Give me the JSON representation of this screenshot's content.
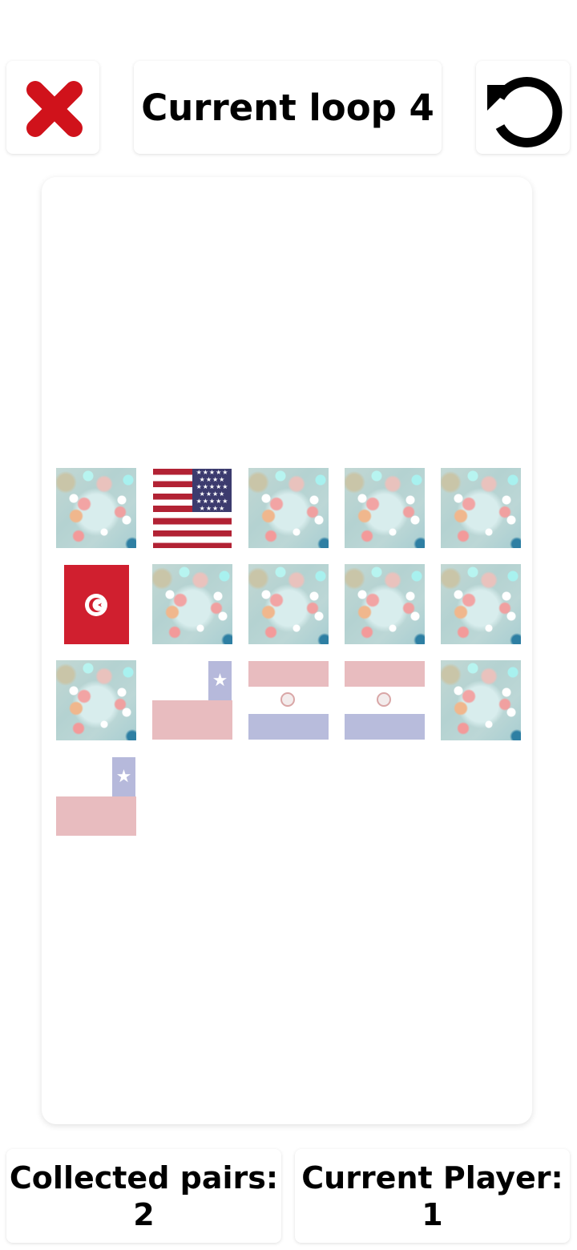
{
  "header": {
    "close_icon": "close-x-icon",
    "close_color": "#d0121b",
    "title": "Current loop 4",
    "restart_icon": "restart-icon"
  },
  "board": {
    "tiles": [
      {
        "state": "hidden"
      },
      {
        "state": "revealed",
        "flag": "USA"
      },
      {
        "state": "hidden"
      },
      {
        "state": "hidden"
      },
      {
        "state": "hidden"
      },
      {
        "state": "revealed",
        "flag": "Tunisia"
      },
      {
        "state": "hidden"
      },
      {
        "state": "hidden"
      },
      {
        "state": "hidden"
      },
      {
        "state": "hidden"
      },
      {
        "state": "hidden"
      },
      {
        "state": "matched",
        "flag": "Chile"
      },
      {
        "state": "matched",
        "flag": "Paraguay"
      },
      {
        "state": "matched",
        "flag": "Paraguay"
      },
      {
        "state": "hidden"
      },
      {
        "state": "matched",
        "flag": "Chile"
      }
    ]
  },
  "stats": {
    "pairs_label": "Collected pairs:",
    "pairs_value": "2",
    "player_label": "Current Player:",
    "player_value": "1"
  }
}
